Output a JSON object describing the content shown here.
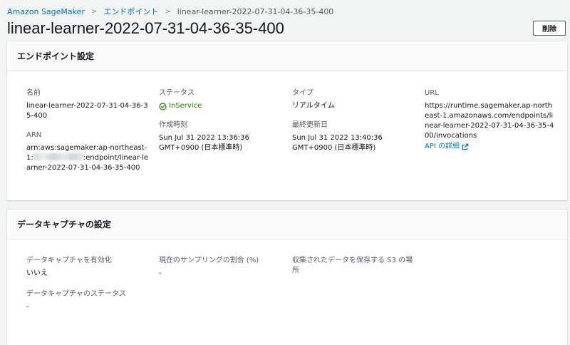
{
  "breadcrumb": {
    "items": [
      "Amazon SageMaker",
      "エンドポイント",
      "linear-learner-2022-07-31-04-36-35-400"
    ]
  },
  "page": {
    "title": "linear-learner-2022-07-31-04-36-35-400",
    "delete_label": "削除"
  },
  "endpoint_settings": {
    "header": "エンドポイント設定",
    "name_label": "名前",
    "name_value": "linear-learner-2022-07-31-04-36-35-400",
    "arn_label": "ARN",
    "arn_prefix": "arn:aws:sagemaker:ap-northeast-1:",
    "arn_suffix": ":endpoint/linear-learner-2022-07-31-04-36-35-400",
    "status_label": "ステータス",
    "status_value": "InService",
    "created_label": "作成時刻",
    "created_value": "Sun Jul 31 2022 13:36:36 GMT+0900 (日本標準時)",
    "type_label": "タイプ",
    "type_value": "リアルタイム",
    "updated_label": "最終更新日",
    "updated_value": "Sun Jul 31 2022 13:40:36 GMT+0900 (日本標準時)",
    "url_label": "URL",
    "url_value": "https://runtime.sagemaker.ap-northeast-1.amazonaws.com/endpoints/linear-learner-2022-07-31-04-36-35-400/invocations",
    "api_link_label": "API の詳細"
  },
  "data_capture": {
    "header": "データキャプチャの設定",
    "enabled_label": "データキャプチャを有効化",
    "enabled_value": "いいえ",
    "sampling_label": "現在のサンプリングの割合 (%)",
    "sampling_value": "-",
    "s3_label": "収集されたデータを保存する S3 の場所",
    "status_label": "データキャプチャのステータス",
    "status_value": "-"
  },
  "colors": {
    "link": "#0073bb",
    "success": "#1d8102",
    "background": "#f2f3f3"
  },
  "icons": [
    "chevron-right-icon",
    "check-circle-icon",
    "external-link-icon"
  ]
}
